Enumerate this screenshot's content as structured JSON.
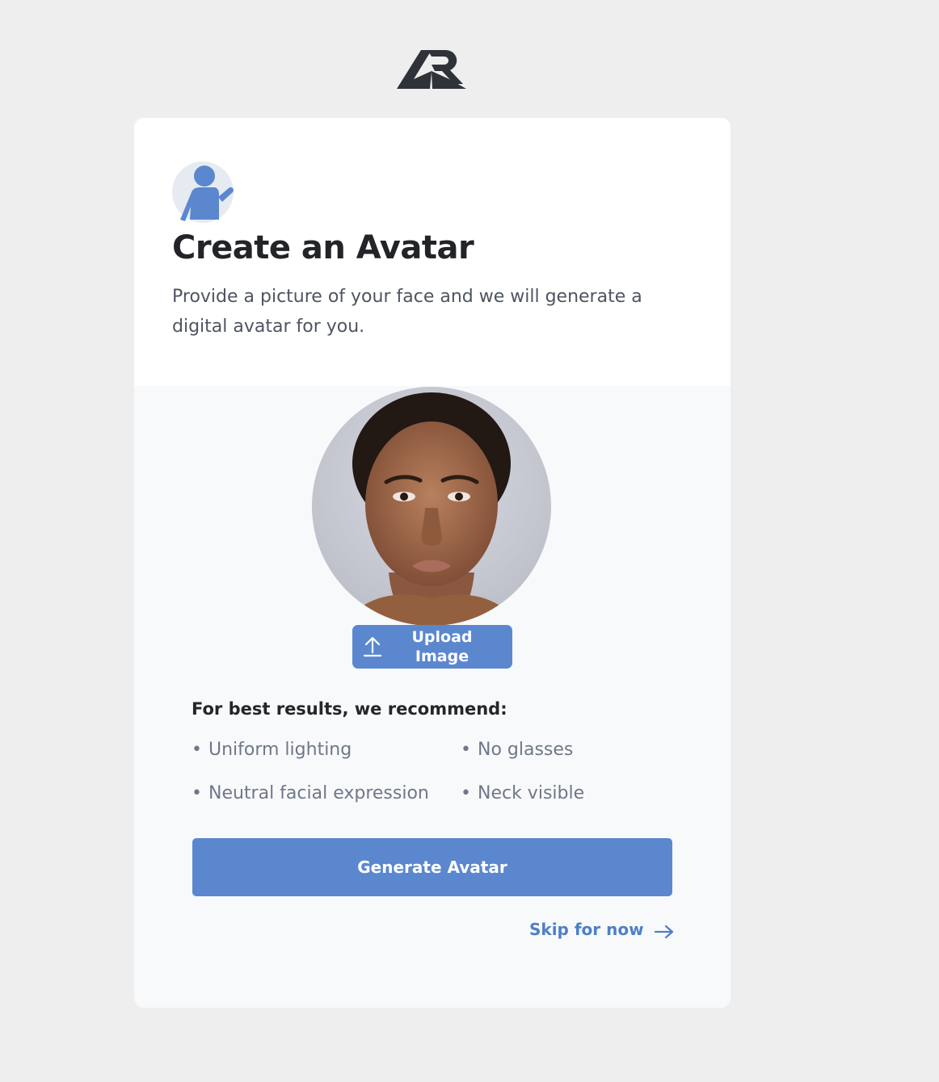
{
  "brand": {
    "logo_icon": "ar-logo-icon"
  },
  "header": {
    "icon": "person-waving-icon",
    "title": "Create an Avatar",
    "description": "Provide a picture of your face and we will generate a digital avatar for you."
  },
  "photo": {
    "image": "uploaded-face-photo"
  },
  "upload": {
    "icon": "upload-icon",
    "label": "Upload Image"
  },
  "recommendations": {
    "heading": "For best results, we recommend:",
    "bullet": "•",
    "items": [
      "Uniform lighting",
      "No glasses",
      "Neutral facial expression",
      "Neck visible"
    ]
  },
  "actions": {
    "generate_label": "Generate Avatar",
    "skip_label": "Skip for now",
    "skip_icon": "arrow-right-icon"
  },
  "colors": {
    "page_background": "#eeeeee",
    "card_background": "#f8f9fb",
    "accent": "#5b87cf",
    "link": "#4f7fc6",
    "heading": "#222428",
    "muted_text": "#6f7888"
  }
}
